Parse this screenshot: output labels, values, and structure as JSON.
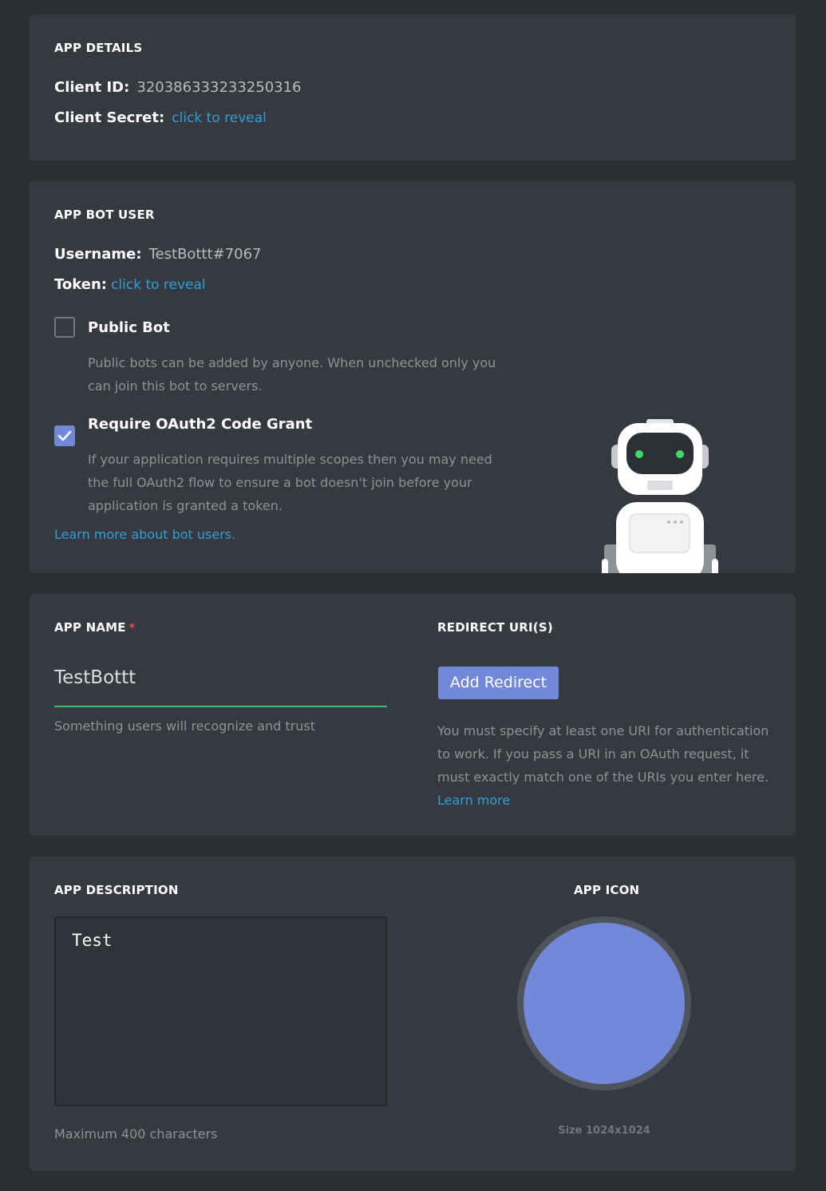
{
  "app_details": {
    "heading": "APP DETAILS",
    "client_id_label": "Client ID:",
    "client_id_value": "320386333233250316",
    "client_secret_label": "Client Secret:",
    "client_secret_link": "click to reveal"
  },
  "bot_user": {
    "heading": "APP BOT USER",
    "username_label": "Username:",
    "username_value": "TestBottt#7067",
    "token_label": "Token:",
    "token_link": "click to reveal",
    "public_bot": {
      "title": "Public Bot",
      "checked": false,
      "description_line1": "Public bots can be added by anyone. When unchecked only you",
      "description_line2": "can join this bot to servers."
    },
    "oauth_grant": {
      "title": "Require OAuth2 Code Grant",
      "checked": true,
      "description_line1": "If your application requires multiple scopes then you may need",
      "description_line2": "the full OAuth2 flow to ensure a bot doesn't join before your",
      "description_line3": "application is granted a token."
    },
    "learn_more_link": "Learn more about bot users."
  },
  "app_name": {
    "heading": "APP NAME",
    "required_mark": "*",
    "value": "TestBottt",
    "hint": "Something users will recognize and trust"
  },
  "redirect": {
    "heading": "REDIRECT URI(S)",
    "button_label": "Add Redirect",
    "description_line1": "You must specify at least one URI for authentication",
    "description_line2": "to work. If you pass a URI in an OAuth request, it",
    "description_line3": "must exactly match one of the URIs you enter here.",
    "learn_more_link": "Learn more"
  },
  "description": {
    "heading": "APP DESCRIPTION",
    "value": "Test",
    "hint": "Maximum 400 characters"
  },
  "app_icon": {
    "heading": "APP ICON",
    "size_text": "Size 1024x1024",
    "color": "#7289da"
  },
  "colors": {
    "background": "#2b2e33",
    "card": "#36393f",
    "link": "#2f9fd8",
    "accent": "#7289da",
    "input_underline": "#43b581"
  }
}
